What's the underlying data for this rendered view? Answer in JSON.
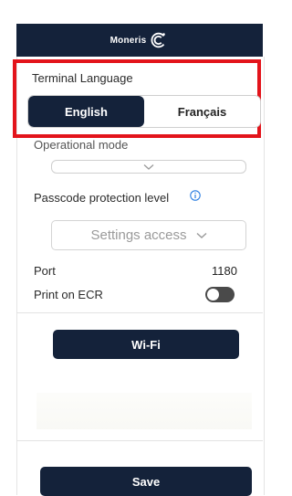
{
  "header": {
    "brand": "Moneris"
  },
  "terminal_language": {
    "label": "Terminal Language",
    "options": [
      "English",
      "Français"
    ],
    "selected": "English"
  },
  "operational_mode": {
    "label": "Operational mode",
    "value": ""
  },
  "passcode": {
    "label": "Passcode protection level",
    "value": "Settings access"
  },
  "port": {
    "label": "Port",
    "value": "1180"
  },
  "print_on_ecr": {
    "label": "Print on ECR",
    "enabled": false
  },
  "buttons": {
    "wifi": "Wi-Fi",
    "save": "Save"
  },
  "colors": {
    "navy": "#14223a",
    "highlight": "#e3141b",
    "info": "#2a7de1"
  }
}
